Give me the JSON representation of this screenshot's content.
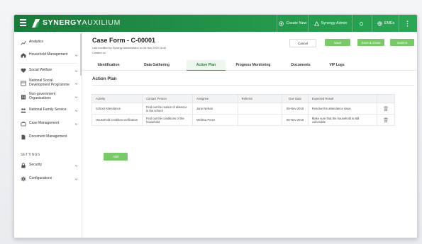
{
  "topbar": {
    "brand_bold": "SYNERGY",
    "brand_light": "AUXILIUM",
    "create_new": "Create New",
    "admin": "Synergy Admin",
    "emails": "EMEs"
  },
  "sidebar": {
    "items": [
      {
        "label": "Analytics",
        "icon": "chart-icon",
        "chevron": false
      },
      {
        "label": "Household Management",
        "icon": "home-icon",
        "chevron": true
      },
      {
        "label": "Social Welfare",
        "icon": "welfare-icon",
        "chevron": true
      },
      {
        "label": "National Social Development Programme",
        "icon": "programme-icon",
        "chevron": true
      },
      {
        "label": "Non-government Organizations",
        "icon": "organization-icon",
        "chevron": true
      },
      {
        "label": "National Family Service",
        "icon": "family-icon",
        "chevron": true
      },
      {
        "label": "Case Management",
        "icon": "case-icon",
        "chevron": true
      },
      {
        "label": "Document Management",
        "icon": "document-icon",
        "chevron": false
      }
    ],
    "settings_label": "SETTINGS",
    "settings_items": [
      {
        "label": "Security",
        "icon": "lock-icon",
        "chevron": true
      },
      {
        "label": "Configurations",
        "icon": "gear-icon",
        "chevron": true
      }
    ]
  },
  "main": {
    "title": "Case Form - C-00001",
    "meta_modified": "Last modified by Synergy Administrator on 06 Nov 2020 16:40",
    "meta_created": "Created on",
    "buttons": {
      "cancel": "Cancel",
      "save": "Save",
      "save_close": "Save & Close",
      "submit": "Submit"
    },
    "tabs": [
      {
        "label": "Identification"
      },
      {
        "label": "Data Gathering"
      },
      {
        "label": "Action Plan",
        "active": true
      },
      {
        "label": "Progress Monitoring"
      },
      {
        "label": "Documents"
      },
      {
        "label": "VIP Logs"
      }
    ],
    "section_title": "Action Plan",
    "table": {
      "headers": [
        "Activity",
        "Contact Person",
        "Assignee",
        "Referral",
        "Due Date",
        "Expected Result",
        ""
      ],
      "rows": [
        [
          "School Attendance",
          "Find out the reason of absence in the school",
          "Jane Nelson",
          "",
          "09-Nov-2018",
          "Resolve the attendance issue"
        ],
        [
          "Household condition verification",
          "Find out the conditions of the household",
          "Melissa Perez",
          "",
          "09-Nov-2018",
          "Make sure that the household is still vulnerable"
        ]
      ]
    },
    "add_label": "Add"
  },
  "colors": {
    "topbar_green": "#1f8a44",
    "accent_green": "#79c96a",
    "active_tab": "#3aa456"
  }
}
